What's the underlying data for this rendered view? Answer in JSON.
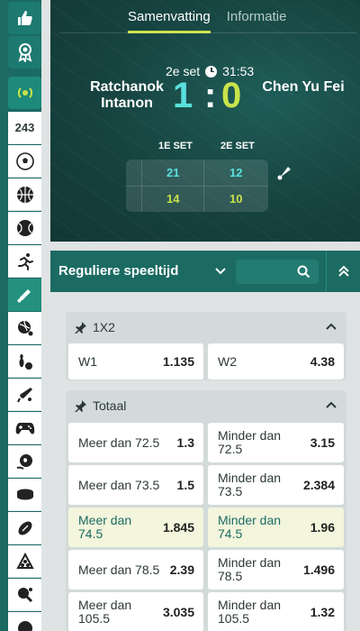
{
  "tabs": [
    {
      "label": "Samenvatting",
      "active": true
    },
    {
      "label": "Informatie",
      "active": false
    }
  ],
  "match": {
    "set_label": "2e set",
    "clock": "31:53",
    "home": {
      "name_line1": "Ratchanok",
      "name_line2": "Intanon",
      "score": "1"
    },
    "away": {
      "name": "Chen Yu Fei",
      "score": "0"
    },
    "sets": {
      "headers": [
        "1E SET",
        "2E SET"
      ],
      "home": [
        "21",
        "12"
      ],
      "away": [
        "14",
        "10"
      ]
    }
  },
  "sidebar": {
    "count": "243",
    "items": [
      {
        "icon": "thumbs-up-icon"
      },
      {
        "icon": "award-icon"
      },
      {
        "icon": "live-icon"
      },
      {
        "icon": "soccer-icon"
      },
      {
        "icon": "basketball-icon"
      },
      {
        "icon": "tennis-icon"
      },
      {
        "icon": "running-icon"
      },
      {
        "icon": "badminton-icon"
      },
      {
        "icon": "volleyball-icon"
      },
      {
        "icon": "bowling-icon"
      },
      {
        "icon": "cricket-icon"
      },
      {
        "icon": "esports-icon"
      },
      {
        "icon": "futsal-icon"
      },
      {
        "icon": "hockey-puck-icon"
      },
      {
        "icon": "rugby-icon"
      },
      {
        "icon": "pool-icon"
      },
      {
        "icon": "table-tennis-icon"
      }
    ]
  },
  "period": {
    "label": "Reguliere speeltijd"
  },
  "search": {
    "placeholder": ""
  },
  "markets": [
    {
      "title": "1X2",
      "rows": [
        [
          {
            "label": "W1",
            "odds": "1.135"
          },
          {
            "label": "W2",
            "odds": "4.38"
          }
        ]
      ]
    },
    {
      "title": "Totaal",
      "rows": [
        [
          {
            "label": "Meer dan 72.5",
            "odds": "1.3"
          },
          {
            "label": "Minder dan 72.5",
            "odds": "3.15"
          }
        ],
        [
          {
            "label": "Meer dan 73.5",
            "odds": "1.5"
          },
          {
            "label": "Minder dan 73.5",
            "odds": "2.384"
          }
        ],
        [
          {
            "label": "Meer dan 74.5",
            "odds": "1.845",
            "highlight": true
          },
          {
            "label": "Minder dan 74.5",
            "odds": "1.96",
            "highlight": true
          }
        ],
        [
          {
            "label": "Meer dan 78.5",
            "odds": "2.39"
          },
          {
            "label": "Minder dan 78.5",
            "odds": "1.496"
          }
        ],
        [
          {
            "label": "Meer dan 105.5",
            "odds": "3.035"
          },
          {
            "label": "Minder dan 105.5",
            "odds": "1.32"
          }
        ]
      ]
    }
  ],
  "colors": {
    "accent": "#c8e34a",
    "home_score": "#59e0de",
    "sidebar": "#1b6b63",
    "highlight_row": "#f3f5dc"
  }
}
